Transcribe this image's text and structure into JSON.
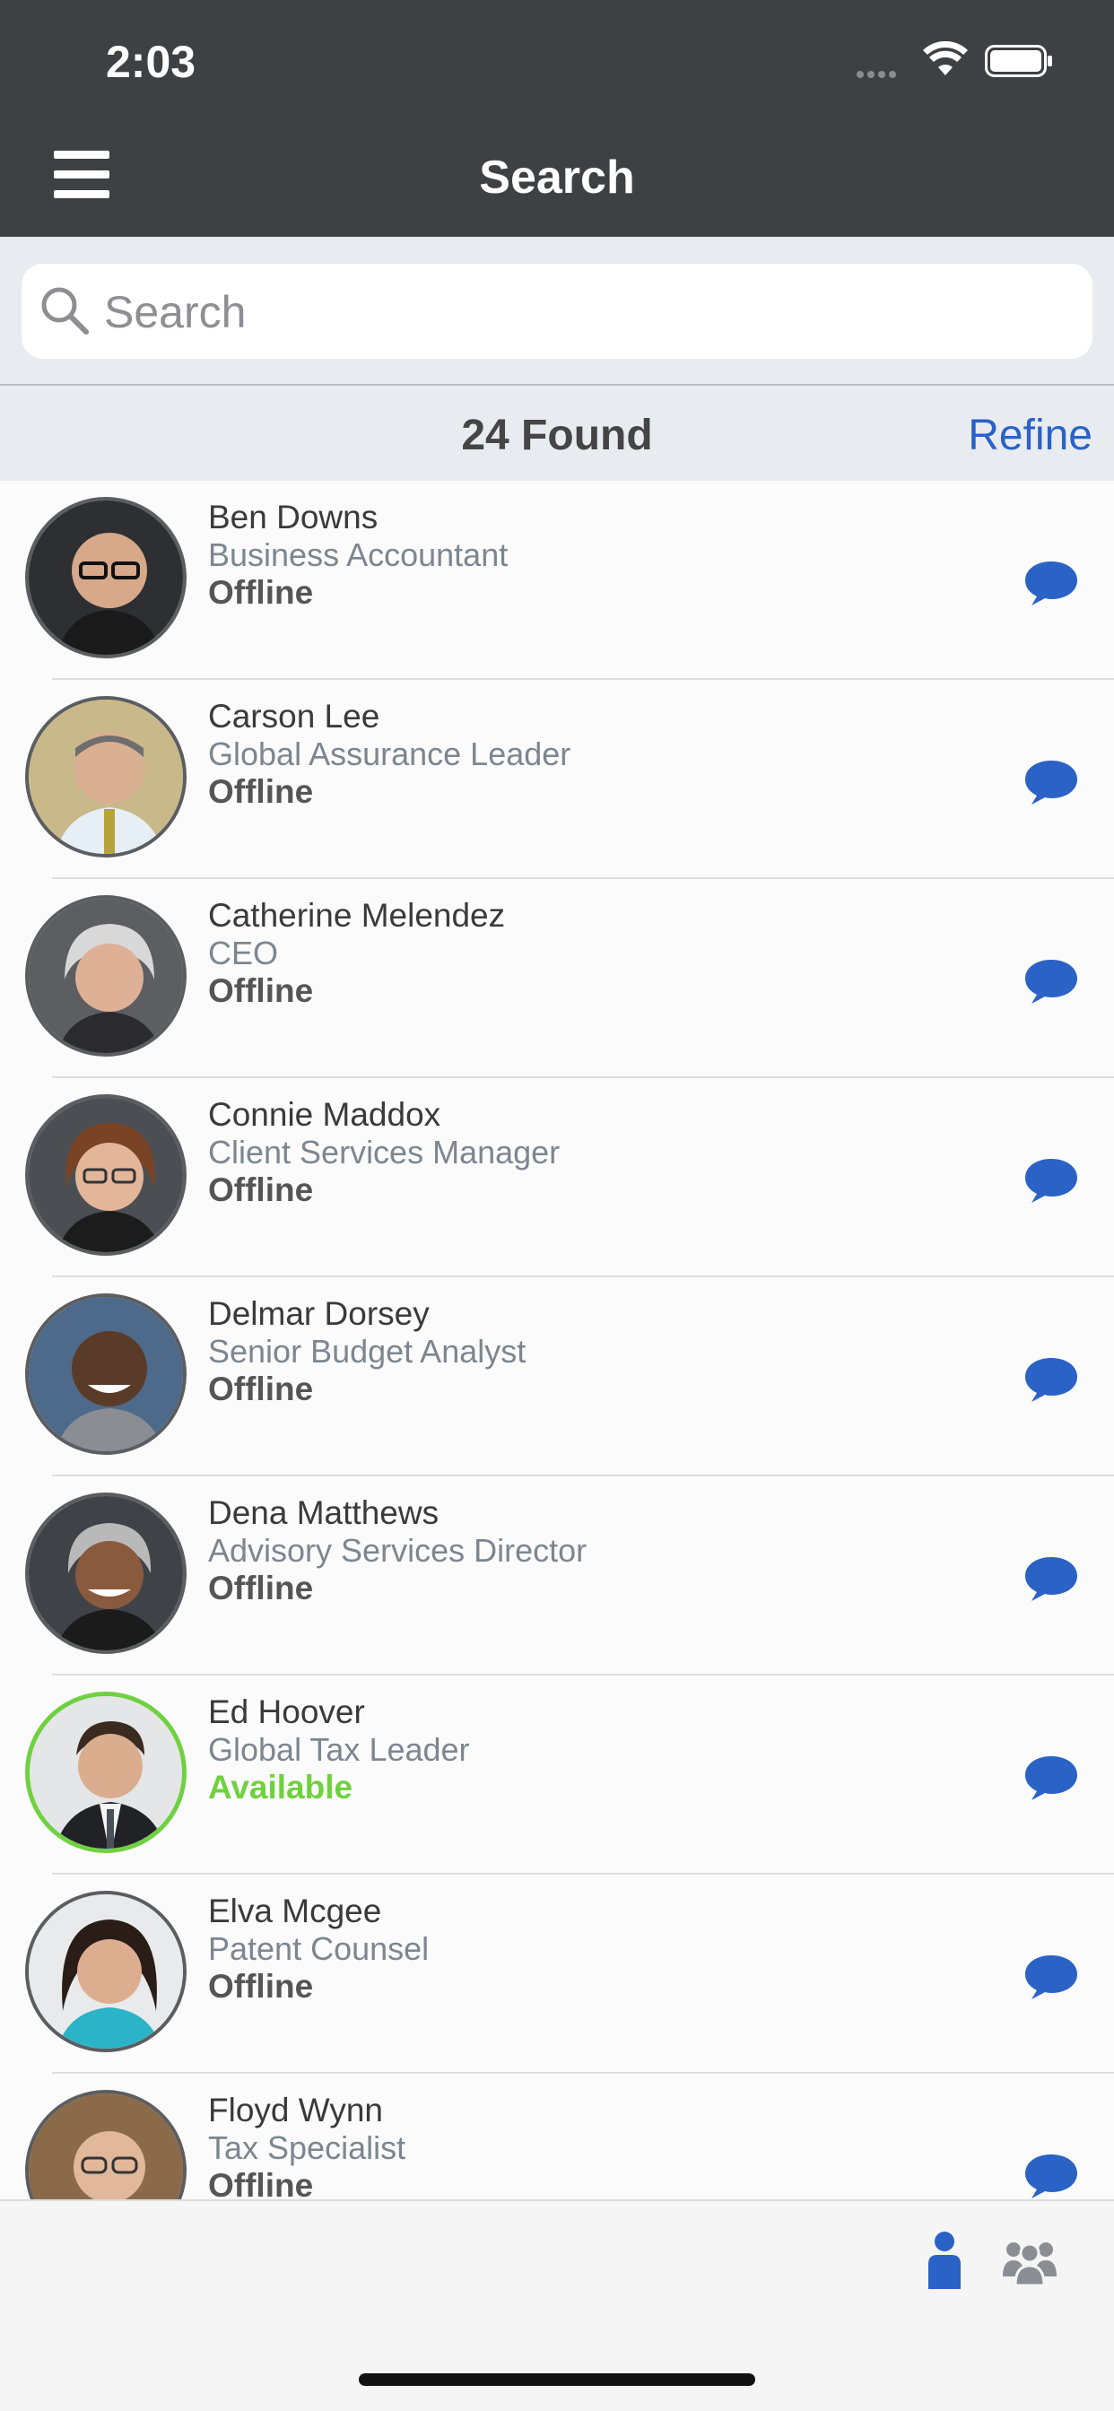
{
  "status_bar": {
    "time": "2:03"
  },
  "nav": {
    "title": "Search",
    "menu_icon": "hamburger-menu-icon"
  },
  "search": {
    "placeholder": "Search",
    "value": ""
  },
  "results": {
    "count_text": "24 Found",
    "refine_label": "Refine"
  },
  "colors": {
    "nav_bg": "#3e4144",
    "accent": "#2a62c5",
    "available": "#6fd13f",
    "offline_text": "#555555"
  },
  "people": [
    {
      "name": "Ben Downs",
      "title": "Business Accountant",
      "status": "Offline"
    },
    {
      "name": "Carson Lee",
      "title": "Global Assurance Leader",
      "status": "Offline"
    },
    {
      "name": "Catherine Melendez",
      "title": "CEO",
      "status": "Offline"
    },
    {
      "name": "Connie Maddox",
      "title": "Client Services Manager",
      "status": "Offline"
    },
    {
      "name": "Delmar Dorsey",
      "title": "Senior Budget Analyst",
      "status": "Offline"
    },
    {
      "name": "Dena Matthews",
      "title": "Advisory Services Director",
      "status": "Offline"
    },
    {
      "name": "Ed Hoover",
      "title": "Global Tax Leader",
      "status": "Available"
    },
    {
      "name": "Elva Mcgee",
      "title": "Patent Counsel",
      "status": "Offline"
    },
    {
      "name": "Floyd Wynn",
      "title": "Tax Specialist",
      "status": "Offline"
    }
  ],
  "tabbar": {
    "items": [
      {
        "icon": "person-icon",
        "active": true
      },
      {
        "icon": "group-icon",
        "active": false
      }
    ]
  }
}
